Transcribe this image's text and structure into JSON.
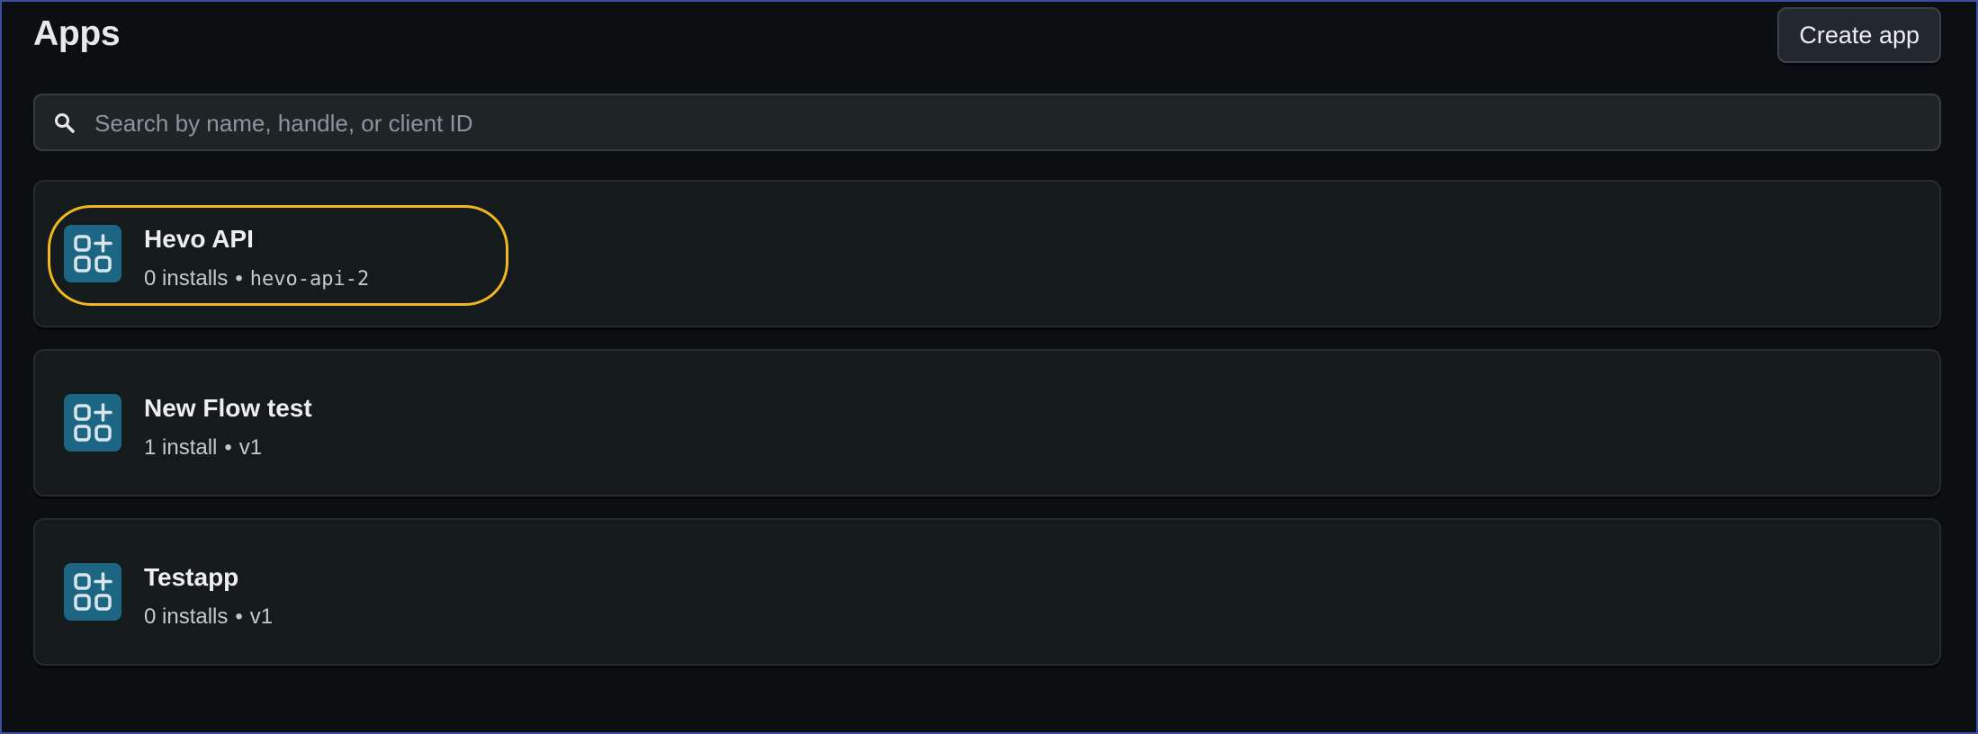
{
  "header": {
    "title": "Apps",
    "create_label": "Create app"
  },
  "search": {
    "placeholder": "Search by name, handle, or client ID",
    "value": "",
    "icon": "search-icon"
  },
  "apps": [
    {
      "name": "Hevo API",
      "installs": "0 installs",
      "separator": "•",
      "handle": "hevo-api-2",
      "handle_monospace": true,
      "highlighted": true,
      "icon": "app-grid-plus-icon"
    },
    {
      "name": "New Flow test",
      "installs": "1 install",
      "separator": "•",
      "handle": "v1",
      "handle_monospace": false,
      "highlighted": false,
      "icon": "app-grid-plus-icon"
    },
    {
      "name": "Testapp",
      "installs": "0 installs",
      "separator": "•",
      "handle": "v1",
      "handle_monospace": false,
      "highlighted": false,
      "icon": "app-grid-plus-icon"
    }
  ],
  "colors": {
    "background": "#0b0f12",
    "card": "#151a1d",
    "app_icon": "#1c6684",
    "highlight": "#f2b71f"
  }
}
